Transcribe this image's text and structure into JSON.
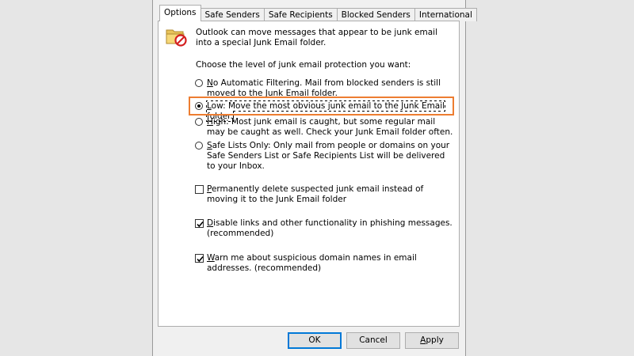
{
  "tabs": [
    {
      "label": "Options"
    },
    {
      "label": "Safe Senders"
    },
    {
      "label": "Safe Recipients"
    },
    {
      "label": "Blocked Senders"
    },
    {
      "label": "International"
    }
  ],
  "intro": "Outlook can move messages that appear to be junk email into a special Junk Email folder.",
  "choose_label": "Choose the level of junk email protection you want:",
  "levels": [
    {
      "accel": "N",
      "rest": "o Automatic Filtering. Mail from blocked senders is still moved to the Junk Email folder.",
      "selected": false
    },
    {
      "accel": "L",
      "rest": "ow: Move the most obvious junk email to the Junk Email folder.",
      "selected": true
    },
    {
      "accel": "H",
      "rest": "igh: Most junk email is caught, but some regular mail may be caught as well. Check your Junk Email folder often.",
      "selected": false
    },
    {
      "accel": "S",
      "rest": "afe Lists Only: Only mail from people or domains on your Safe Senders List or Safe Recipients List will be delivered to your Inbox.",
      "selected": false
    }
  ],
  "checkboxes": [
    {
      "accel": "P",
      "rest": "ermanently delete suspected junk email instead of moving it to the Junk Email folder",
      "checked": false
    },
    {
      "accel": "D",
      "rest": "isable links and other functionality in phishing messages. (recommended)",
      "checked": true
    },
    {
      "accel": "W",
      "rest": "arn me about suspicious domain names in email addresses. (recommended)",
      "checked": true
    }
  ],
  "buttons": {
    "ok": "OK",
    "cancel": "Cancel",
    "apply_accel": "A",
    "apply_rest": "pply"
  },
  "icon": "junk-folder-block-icon",
  "colors": {
    "highlight": "#ed7d31",
    "default_button_border": "#0078d7"
  }
}
